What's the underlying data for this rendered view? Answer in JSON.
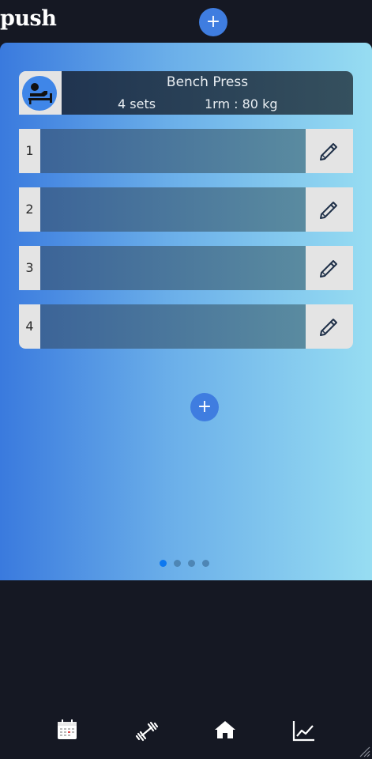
{
  "app": {
    "title": "push"
  },
  "exercise": {
    "name": "Bench Press",
    "sets_text": "4 sets",
    "one_rm_text": "1rm : 80 kg",
    "icon": "bench-press-icon"
  },
  "sets": [
    {
      "number": "1"
    },
    {
      "number": "2"
    },
    {
      "number": "3"
    },
    {
      "number": "4"
    }
  ],
  "buttons": {
    "add_label": "+"
  },
  "carousel": {
    "pages": 4,
    "active_index": 0
  },
  "bottom_nav": [
    {
      "name": "calendar",
      "icon": "calendar-icon"
    },
    {
      "name": "workouts",
      "icon": "dumbbell-icon"
    },
    {
      "name": "home",
      "icon": "home-icon"
    },
    {
      "name": "progress",
      "icon": "chart-line-icon"
    }
  ],
  "colors": {
    "background": "#151823",
    "accent": "#3f7de0",
    "panel_gradient": [
      "#3a7ade",
      "#97ddf2"
    ],
    "active_dot": "#0d78f0"
  }
}
